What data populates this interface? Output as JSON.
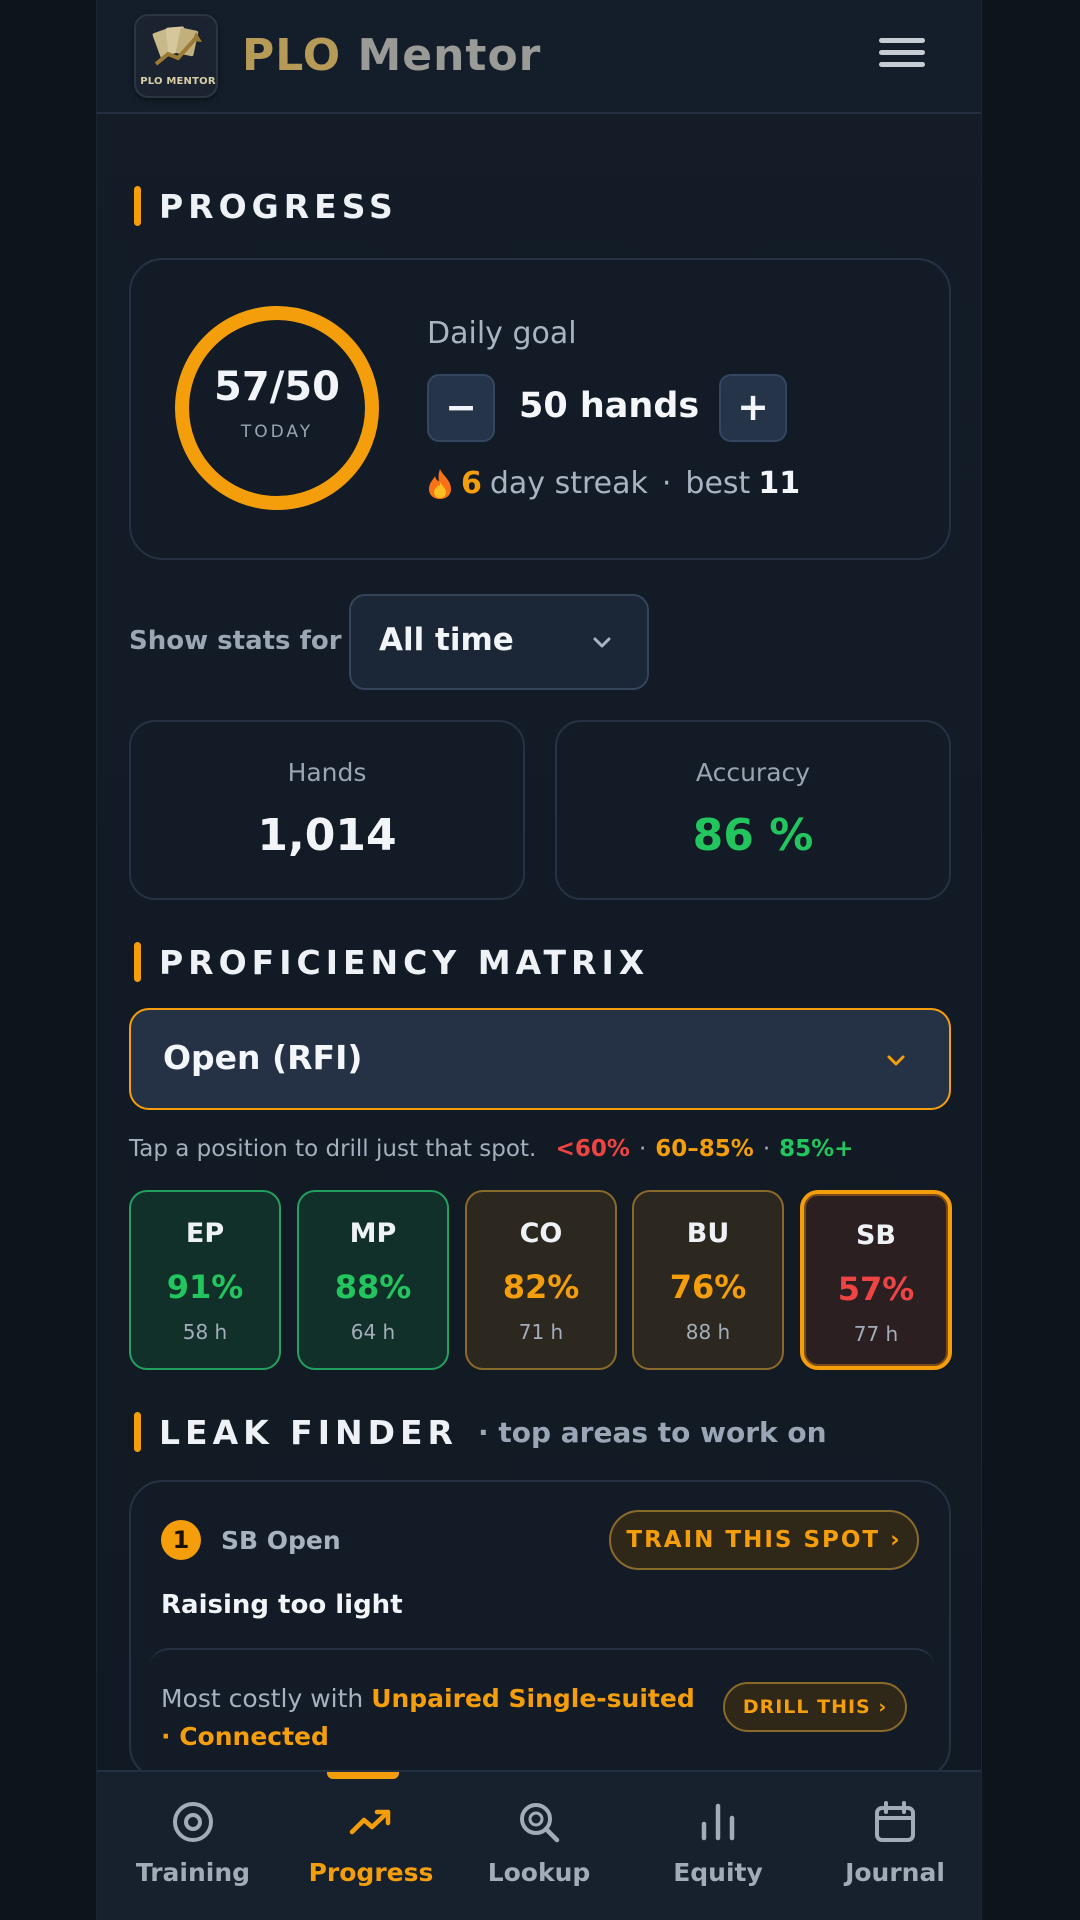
{
  "header": {
    "logo_text": "PLO MENTOR",
    "brand_part1": "PLO",
    "brand_part2": "Mentor"
  },
  "progress": {
    "section_title": "PROGRESS",
    "ring_value": "57/50",
    "ring_label": "TODAY",
    "ring_fraction": 1.0,
    "goal_label": "Daily goal",
    "goal_value": "50 hands",
    "minus_label": "−",
    "plus_label": "+",
    "streak_icon": "flame-icon",
    "streak_count": "6",
    "streak_text": "day streak",
    "best_label": "best",
    "best_value": "11"
  },
  "filter": {
    "label": "Show stats for",
    "value": "All time"
  },
  "stats": [
    {
      "label": "Hands",
      "value": "1,014"
    },
    {
      "label": "Accuracy",
      "value": "86 %"
    }
  ],
  "matrix": {
    "section_title": "PROFICIENCY MATRIX",
    "select_value": "Open (RFI)",
    "hint": "Tap a position to drill just that spot.",
    "legend_low": "<60%",
    "legend_mid": "60–85%",
    "legend_high": "85%+",
    "positions": [
      {
        "name": "EP",
        "pct": "91%",
        "hands": "58 h"
      },
      {
        "name": "MP",
        "pct": "88%",
        "hands": "64 h"
      },
      {
        "name": "CO",
        "pct": "82%",
        "hands": "71 h"
      },
      {
        "name": "BU",
        "pct": "76%",
        "hands": "88 h"
      },
      {
        "name": "SB",
        "pct": "57%",
        "hands": "77 h"
      }
    ]
  },
  "leak": {
    "section_title": "LEAK FINDER",
    "section_sub": "· top areas to work on",
    "rank": "1",
    "spot": "SB Open",
    "train_label": "TRAIN THIS SPOT ›",
    "title": "Raising too light",
    "costly_prefix": "Most costly with",
    "costly_highlight": "Unpaired Single-suited · Connected",
    "drill_label": "DRILL THIS ›"
  },
  "nav": {
    "items": [
      {
        "label": "Training",
        "icon": "target-icon"
      },
      {
        "label": "Progress",
        "icon": "trending-up-icon"
      },
      {
        "label": "Lookup",
        "icon": "search-icon"
      },
      {
        "label": "Equity",
        "icon": "bar-chart-icon"
      },
      {
        "label": "Journal",
        "icon": "calendar-icon"
      }
    ],
    "active": "Progress"
  },
  "colors": {
    "accent": "#f59e0b",
    "good": "#22c55e",
    "bad": "#ef4444"
  }
}
